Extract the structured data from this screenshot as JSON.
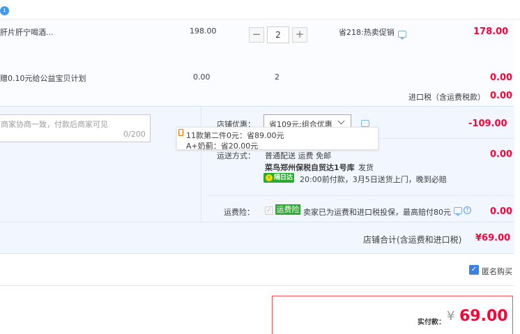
{
  "header": {
    "badge": "1"
  },
  "item": {
    "title": "肝片肝宁喝酒...",
    "unit_price": "198.00",
    "quantity": "2",
    "minus": "−",
    "plus": "+",
    "promo": "省218:热卖促销",
    "subtotal": "178.00"
  },
  "gift": {
    "title": "赠0.10元给公益宝贝计划",
    "unit_price": "0.00",
    "quantity": "2",
    "subtotal": "0.00"
  },
  "import_tax": {
    "label": "进口税（含运费税款）",
    "value": "0.00"
  },
  "memo": {
    "placeholder": "商家协商一致，付款后商家可见",
    "counter": "0/200"
  },
  "shop_discount": {
    "label": "店铺优惠：",
    "selected": "省109元:组合优惠",
    "value": "-109.00",
    "details": [
      "11款第二件0元：省89.00元",
      "A+奶蓟：省20.00元"
    ]
  },
  "shipping": {
    "label": "运送方式：",
    "method": "普通配送 运费 免邮",
    "warehouse": "菜鸟郑州保税自贸达1号库",
    "ship_note": "发货",
    "flash_label": "隔日达",
    "flash_bolt": "⚡",
    "delivery_note": "20:00前付款，3月5日送货上门，晚到必赔",
    "value": "0.00"
  },
  "insurance": {
    "label": "运费险：",
    "tag": "运费险",
    "desc": "卖家已为运费和进口税投保，最高赔付80元",
    "help": "?",
    "value": "0.00"
  },
  "shop_total": {
    "label": "店铺合计(含运费和进口税)",
    "value": "¥69.00"
  },
  "anonymous": {
    "label": "匿名购买",
    "check": "✓"
  },
  "payment": {
    "label": "实付款：",
    "currency": "¥",
    "amount": "69.00"
  },
  "colors": {
    "accent": "#ff0036",
    "link": "#3d7fe3",
    "green": "#2bab2d"
  }
}
